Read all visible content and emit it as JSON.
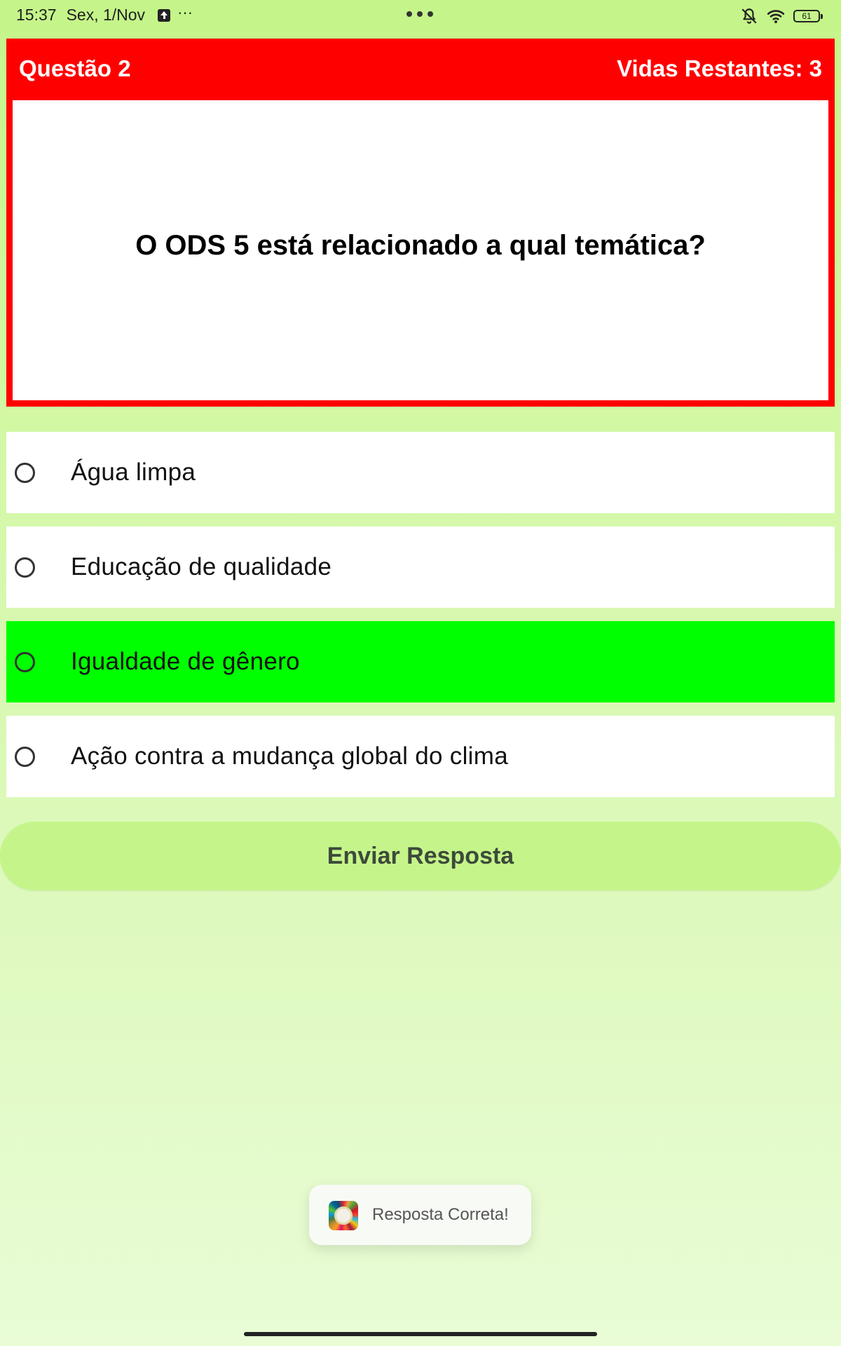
{
  "status_bar": {
    "time": "15:37",
    "date": "Sex, 1/Nov",
    "battery": "61",
    "icons": [
      "upload-icon",
      "more-icon",
      "bell-off-icon",
      "wifi-icon",
      "battery-icon"
    ]
  },
  "header": {
    "question_label": "Questão 2",
    "lives_label": "Vidas Restantes: 3",
    "color": "#ff0000"
  },
  "question": {
    "text": "O ODS 5 está relacionado a qual temática?"
  },
  "options": [
    {
      "label": "Água limpa",
      "state": "default"
    },
    {
      "label": "Educação de qualidade",
      "state": "default"
    },
    {
      "label": "Igualdade de gênero",
      "state": "correct"
    },
    {
      "label": "Ação contra a mudança global do clima",
      "state": "default"
    }
  ],
  "submit": {
    "label": "Enviar Resposta"
  },
  "toast": {
    "text": "Resposta Correta!"
  },
  "colors": {
    "background": "#c5f58a",
    "correct": "#00ff00",
    "header": "#ff0000"
  }
}
